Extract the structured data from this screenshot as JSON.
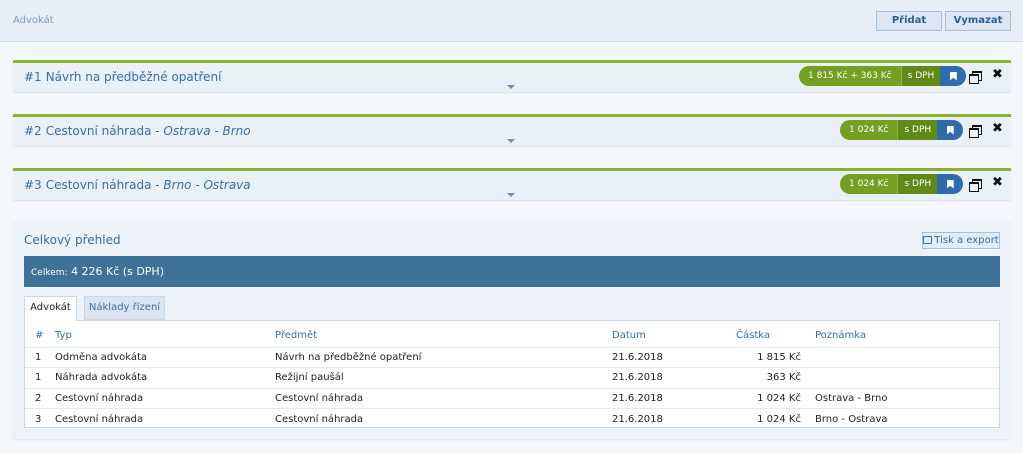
{
  "header": {
    "title": "Advokát",
    "add_label": "Přidat",
    "clear_label": "Vymazat"
  },
  "items": [
    {
      "num": "#1",
      "title": "Návrh na předběžné opatření",
      "route": "",
      "amount": "1 815 Kč + 363 Kč",
      "vat": "s DPH"
    },
    {
      "num": "#2",
      "title": "Cestovní náhrada - ",
      "route": "Ostrava - Brno",
      "amount": "1 024 Kč",
      "vat": "s DPH"
    },
    {
      "num": "#3",
      "title": "Cestovní náhrada - ",
      "route": "Brno - Ostrava",
      "amount": "1 024 Kč",
      "vat": "s DPH"
    }
  ],
  "summary": {
    "title": "Celkový přehled",
    "print_label": "Tisk a export",
    "total_label": "Celkem:",
    "total_value": "4 226 Kč (s DPH)",
    "tabs": [
      "Advokát",
      "Náklady řízení"
    ],
    "columns": [
      "#",
      "Typ",
      "Předmět",
      "Datum",
      "Částka",
      "Poznámka"
    ],
    "rows": [
      [
        "1",
        "Odměna advokáta",
        "Návrh na předběžné opatření",
        "21.6.2018",
        "1 815 Kč",
        ""
      ],
      [
        "1",
        "Náhrada advokáta",
        "Režijní paušál",
        "21.6.2018",
        "363 Kč",
        ""
      ],
      [
        "2",
        "Cestovní náhrada",
        "Cestovní náhrada",
        "21.6.2018",
        "1 024 Kč",
        "Ostrava - Brno"
      ],
      [
        "3",
        "Cestovní náhrada",
        "Cestovní náhrada",
        "21.6.2018",
        "1 024 Kč",
        "Brno - Ostrava"
      ]
    ]
  },
  "colors": {
    "accent_green": "#73a020",
    "accent_blue": "#3e7299",
    "link_blue": "#3a6ea5"
  }
}
